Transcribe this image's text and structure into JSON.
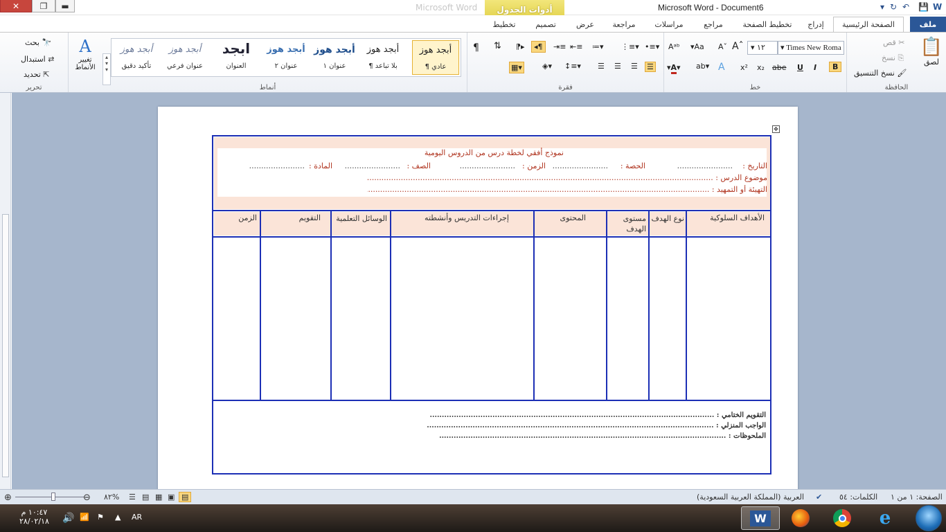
{
  "titlebar": {
    "document_title": "Microsoft Word  -  Document6",
    "background_title": "Microsoft Word",
    "contextual_tab_group": "أدوات الجدول",
    "close_glyph": "✕",
    "maximize_glyph": "❐",
    "minimize_glyph": "▬"
  },
  "tabs": {
    "file": "ملف",
    "home": "الصفحة الرئيسية",
    "insert": "إدراج",
    "page_layout": "تخطيط الصفحة",
    "references": "مراجع",
    "mailings": "مراسلات",
    "review": "مراجعة",
    "view": "عرض",
    "design": "تصميم",
    "layout": "تخطيط"
  },
  "clipboard": {
    "group": "الحافظة",
    "paste": "لصق",
    "cut": "قص",
    "copy": "نسخ",
    "format_painter": "نسخ التنسيق"
  },
  "font": {
    "group": "خط",
    "name": "Times New Roma",
    "size": "١٢",
    "bold": "B",
    "italic": "I",
    "underline": "U",
    "strike": "abe",
    "subscript": "x₂",
    "superscript": "x²",
    "change_case": "Aa",
    "grow": "A",
    "shrink": "A"
  },
  "paragraph": {
    "group": "فقرة",
    "pilcrow": "¶"
  },
  "styles": {
    "group": "أنماط",
    "change_styles": "تغيير الأنماط",
    "items": [
      {
        "sample": "أبجد هوز",
        "name": "¶ عادي"
      },
      {
        "sample": "أبجد هوز",
        "name": "¶ بلا تباعد"
      },
      {
        "sample": "أبجد هوز",
        "name": "عنوان ١"
      },
      {
        "sample": "أبجد هوز",
        "name": "عنوان ٢"
      },
      {
        "sample": "ابجد",
        "name": "العنوان"
      },
      {
        "sample": "أبجد هوز",
        "name": "عنوان فرعي"
      },
      {
        "sample": "أبجد هوز",
        "name": "تأكيد دقيق"
      }
    ]
  },
  "editing": {
    "group": "تحرير",
    "find": "بحث",
    "replace": "استبدال",
    "select": "تحديد"
  },
  "document": {
    "header_title": "نموذج أفقي لخطة درس من الدروس اليومية",
    "date_label": "التاريخ :",
    "date_dots": ".......................",
    "period_label": "الحصة :",
    "period_dots": ".......................",
    "time_label": "الزمن :",
    "time_dots": ".......................",
    "class_label": "الصف :",
    "class_dots": ".......................",
    "subject_label": "المادة :",
    "subject_dots": ".......................",
    "topic_line": "موضوع الدرس : .......................................................................................................................................................",
    "intro_line": "التهيئة أو التمهيد : ...................................................................................................................................................",
    "columns": [
      "الأهداف السلوكية",
      "نوع الهدف",
      "مستوى الهدف",
      "المحتوى",
      "إجراءات التدريس وأنشطته",
      "الوسائل التعلمية",
      "التقويم",
      "الزمن"
    ],
    "final_eval": "التقويم الختامي : ......................................................................................................................",
    "homework": "الواجب المنزلي : .......................................................................................................................",
    "notes": "الملحوظات : ......................................................................................................................."
  },
  "statusbar": {
    "page": "الصفحة: ١ من ١",
    "words": "الكلمات: ٥٤",
    "language": "العربية (المملكة العربية السعودية)",
    "zoom": "٨٢%"
  },
  "taskbar": {
    "lang": "AR",
    "time": "١٠:٤٧ م",
    "date": "٢٨/٠٢/١٨"
  }
}
